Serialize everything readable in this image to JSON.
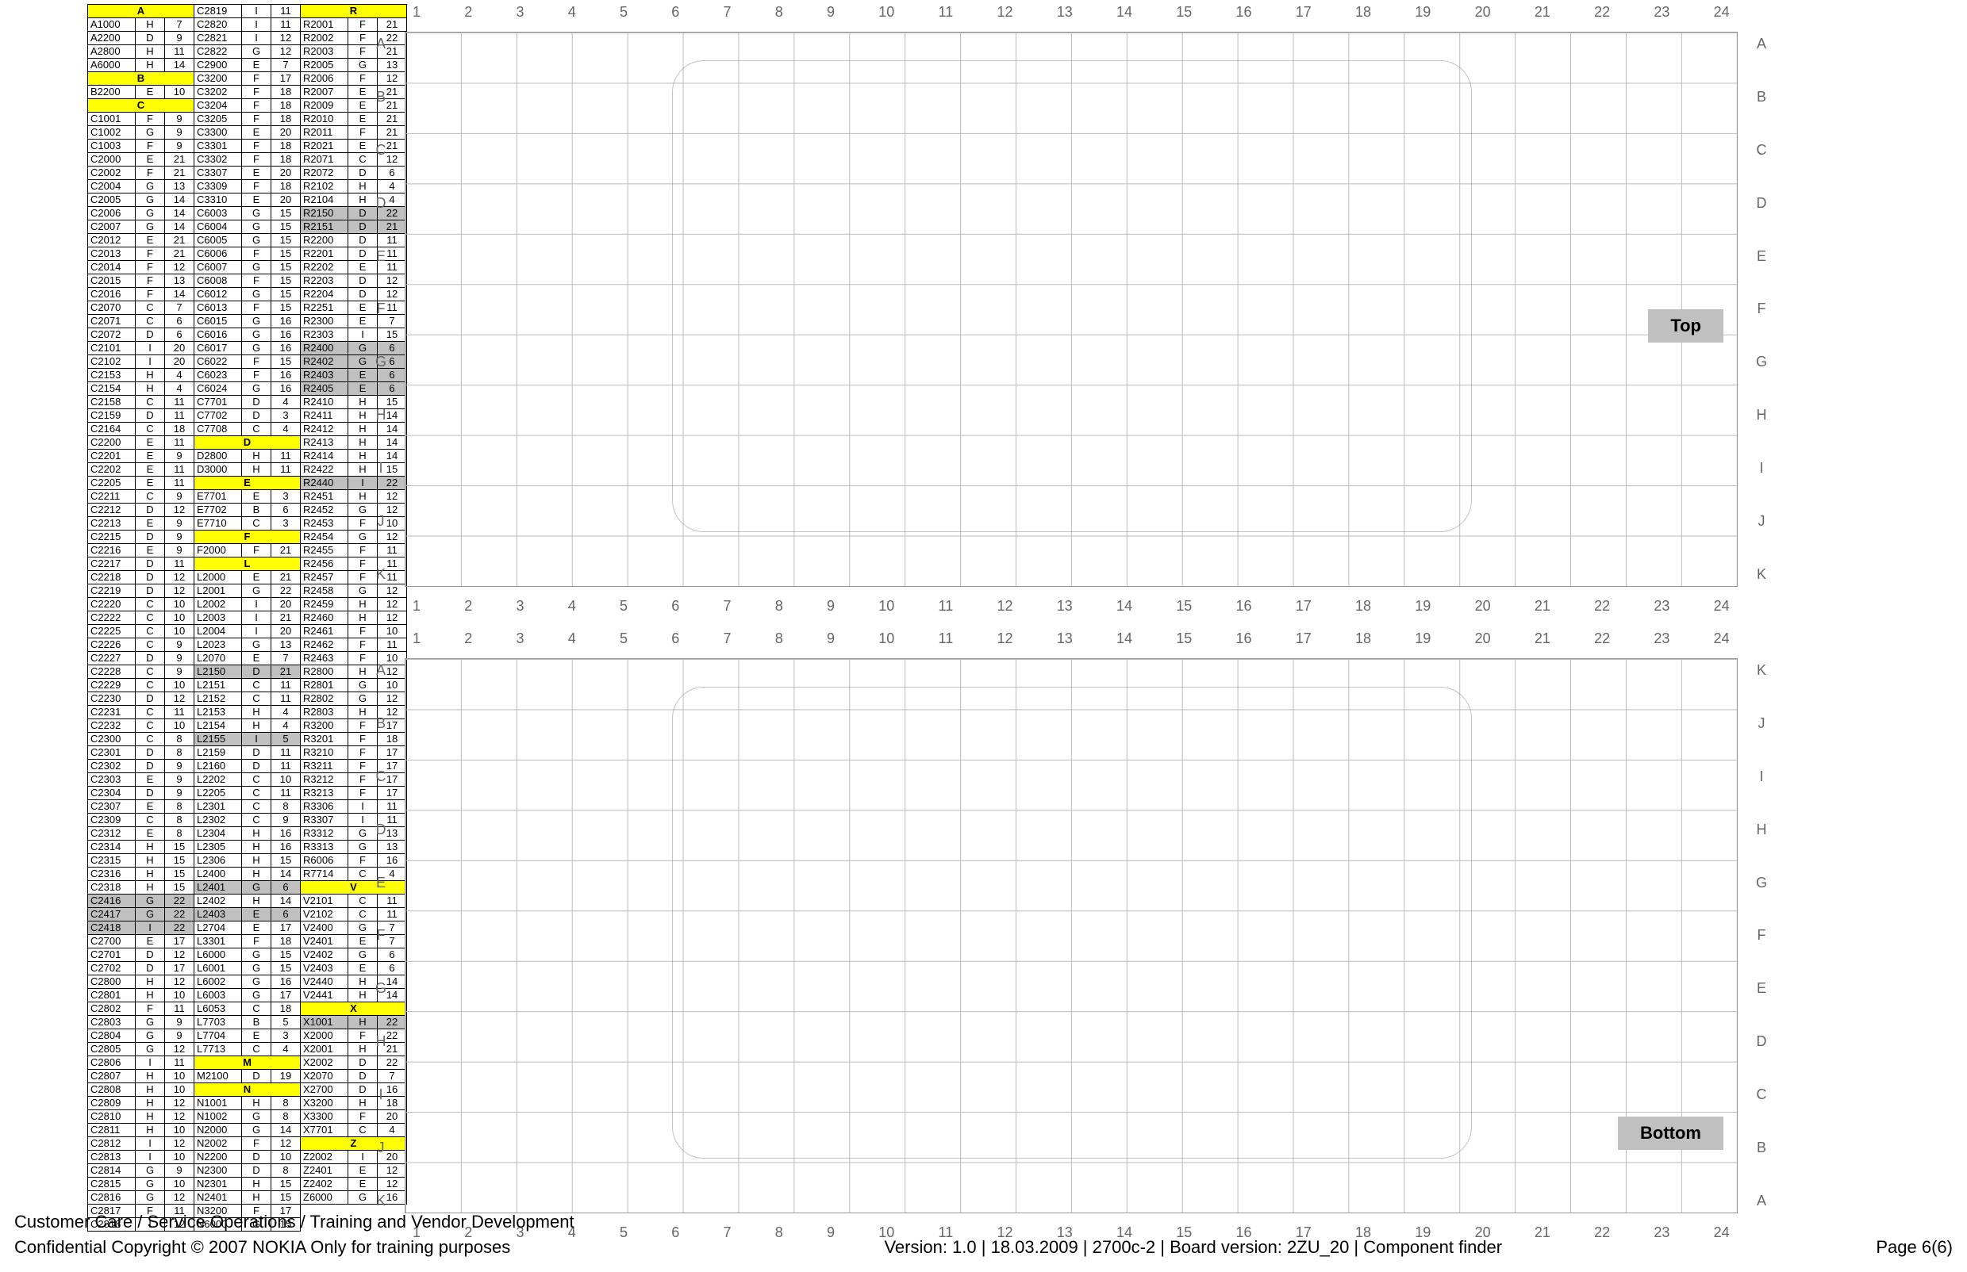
{
  "side_labels": {
    "top": "Top",
    "bottom": "Bottom"
  },
  "grid_cols": [
    "1",
    "2",
    "3",
    "4",
    "5",
    "6",
    "7",
    "8",
    "9",
    "10",
    "11",
    "12",
    "13",
    "14",
    "15",
    "16",
    "17",
    "18",
    "19",
    "20",
    "21",
    "22",
    "23",
    "24"
  ],
  "grid_rows": [
    "A",
    "B",
    "C",
    "D",
    "E",
    "F",
    "G",
    "H",
    "I",
    "J",
    "K"
  ],
  "footer": {
    "line1": "Customer Care / Service Operations / Training and Vendor Development",
    "line2": "Confidential Copyright © 2007 NOKIA Only for training purposes",
    "version": "Version: 1.0 | 18.03.2009 | 2700c-2 | Board version: 2ZU_20 | Component finder",
    "page": "Page 6(6)"
  },
  "columns": [
    [
      {
        "hdr": "A"
      },
      [
        "A1000",
        "H",
        "7"
      ],
      [
        "A2200",
        "D",
        "9"
      ],
      [
        "A2800",
        "H",
        "11"
      ],
      [
        "A6000",
        "H",
        "14"
      ],
      {
        "hdr": "B"
      },
      [
        "B2200",
        "E",
        "10"
      ],
      {
        "hdr": "C"
      },
      [
        "C1001",
        "F",
        "9"
      ],
      [
        "C1002",
        "G",
        "9"
      ],
      [
        "C1003",
        "F",
        "9"
      ],
      [
        "C2000",
        "E",
        "21"
      ],
      [
        "C2002",
        "F",
        "21"
      ],
      [
        "C2004",
        "G",
        "13"
      ],
      [
        "C2005",
        "G",
        "14"
      ],
      [
        "C2006",
        "G",
        "14"
      ],
      [
        "C2007",
        "G",
        "14"
      ],
      [
        "C2012",
        "E",
        "21"
      ],
      [
        "C2013",
        "F",
        "21"
      ],
      [
        "C2014",
        "F",
        "12"
      ],
      [
        "C2015",
        "F",
        "13"
      ],
      [
        "C2016",
        "F",
        "14"
      ],
      [
        "C2070",
        "C",
        "7"
      ],
      [
        "C2071",
        "C",
        "6"
      ],
      [
        "C2072",
        "D",
        "6"
      ],
      [
        "C2101",
        "I",
        "20"
      ],
      [
        "C2102",
        "I",
        "20"
      ],
      [
        "C2153",
        "H",
        "4"
      ],
      [
        "C2154",
        "H",
        "4"
      ],
      [
        "C2158",
        "C",
        "11"
      ],
      [
        "C2159",
        "D",
        "11"
      ],
      [
        "C2164",
        "C",
        "18"
      ],
      [
        "C2200",
        "E",
        "11"
      ],
      [
        "C2201",
        "E",
        "9"
      ],
      [
        "C2202",
        "E",
        "11"
      ],
      [
        "C2205",
        "E",
        "11"
      ],
      [
        "C2211",
        "C",
        "9"
      ],
      [
        "C2212",
        "D",
        "12"
      ],
      [
        "C2213",
        "E",
        "9"
      ],
      [
        "C2215",
        "D",
        "9"
      ],
      [
        "C2216",
        "E",
        "9"
      ],
      [
        "C2217",
        "D",
        "11"
      ],
      [
        "C2218",
        "D",
        "12"
      ],
      [
        "C2219",
        "D",
        "12"
      ],
      [
        "C2220",
        "C",
        "10"
      ],
      [
        "C2222",
        "C",
        "10"
      ],
      [
        "C2225",
        "C",
        "10"
      ],
      [
        "C2226",
        "C",
        "9"
      ],
      [
        "C2227",
        "D",
        "9"
      ],
      [
        "C2228",
        "C",
        "9"
      ],
      [
        "C2229",
        "C",
        "10"
      ],
      [
        "C2230",
        "D",
        "12"
      ],
      [
        "C2231",
        "C",
        "11"
      ],
      [
        "C2232",
        "C",
        "10"
      ],
      [
        "C2300",
        "C",
        "8"
      ],
      [
        "C2301",
        "D",
        "8"
      ],
      [
        "C2302",
        "D",
        "9"
      ],
      [
        "C2303",
        "E",
        "9"
      ],
      [
        "C2304",
        "D",
        "9"
      ],
      [
        "C2307",
        "E",
        "8"
      ],
      [
        "C2309",
        "C",
        "8"
      ],
      [
        "C2312",
        "E",
        "8"
      ],
      [
        "C2314",
        "H",
        "15"
      ],
      [
        "C2315",
        "H",
        "15"
      ],
      [
        "C2316",
        "H",
        "15"
      ],
      [
        "C2318",
        "H",
        "15"
      ],
      [
        "C2416",
        "G",
        "22",
        "hl"
      ],
      [
        "C2417",
        "G",
        "22",
        "hl"
      ],
      [
        "C2418",
        "I",
        "22",
        "hl"
      ],
      [
        "C2700",
        "E",
        "17"
      ],
      [
        "C2701",
        "D",
        "12"
      ],
      [
        "C2702",
        "D",
        "17"
      ],
      [
        "C2800",
        "H",
        "12"
      ],
      [
        "C2801",
        "H",
        "10"
      ],
      [
        "C2802",
        "F",
        "11"
      ],
      [
        "C2803",
        "G",
        "9"
      ],
      [
        "C2804",
        "G",
        "9"
      ],
      [
        "C2805",
        "G",
        "12"
      ],
      [
        "C2806",
        "I",
        "11"
      ],
      [
        "C2807",
        "H",
        "10"
      ],
      [
        "C2808",
        "H",
        "10"
      ],
      [
        "C2809",
        "H",
        "12"
      ],
      [
        "C2810",
        "H",
        "12"
      ],
      [
        "C2811",
        "H",
        "10"
      ],
      [
        "C2812",
        "I",
        "12"
      ],
      [
        "C2813",
        "I",
        "10"
      ],
      [
        "C2814",
        "G",
        "9"
      ],
      [
        "C2815",
        "G",
        "10"
      ],
      [
        "C2816",
        "G",
        "12"
      ],
      [
        "C2817",
        "F",
        "11"
      ],
      [
        "C2818",
        "I",
        "12"
      ]
    ],
    [
      [
        "C2819",
        "I",
        "11"
      ],
      [
        "C2820",
        "I",
        "11"
      ],
      [
        "C2821",
        "I",
        "12"
      ],
      [
        "C2822",
        "G",
        "12"
      ],
      [
        "C2900",
        "E",
        "7"
      ],
      [
        "C3200",
        "F",
        "17"
      ],
      [
        "C3202",
        "F",
        "18"
      ],
      [
        "C3204",
        "F",
        "18"
      ],
      [
        "C3205",
        "F",
        "18"
      ],
      [
        "C3300",
        "E",
        "20"
      ],
      [
        "C3301",
        "F",
        "18"
      ],
      [
        "C3302",
        "F",
        "18"
      ],
      [
        "C3307",
        "E",
        "20"
      ],
      [
        "C3309",
        "F",
        "18"
      ],
      [
        "C3310",
        "E",
        "20"
      ],
      [
        "C6003",
        "G",
        "15"
      ],
      [
        "C6004",
        "G",
        "15"
      ],
      [
        "C6005",
        "G",
        "15"
      ],
      [
        "C6006",
        "F",
        "15"
      ],
      [
        "C6007",
        "G",
        "15"
      ],
      [
        "C6008",
        "F",
        "15"
      ],
      [
        "C6012",
        "G",
        "15"
      ],
      [
        "C6013",
        "F",
        "15"
      ],
      [
        "C6015",
        "G",
        "16"
      ],
      [
        "C6016",
        "G",
        "16"
      ],
      [
        "C6017",
        "G",
        "16"
      ],
      [
        "C6022",
        "F",
        "15"
      ],
      [
        "C6023",
        "F",
        "16"
      ],
      [
        "C6024",
        "G",
        "16"
      ],
      [
        "C7701",
        "D",
        "4"
      ],
      [
        "C7702",
        "D",
        "3"
      ],
      [
        "C7708",
        "C",
        "4"
      ],
      {
        "hdr": "D"
      },
      [
        "D2800",
        "H",
        "11"
      ],
      [
        "D3000",
        "H",
        "11"
      ],
      {
        "hdr": "E"
      },
      [
        "E7701",
        "E",
        "3"
      ],
      [
        "E7702",
        "B",
        "6"
      ],
      [
        "E7710",
        "C",
        "3"
      ],
      {
        "hdr": "F"
      },
      [
        "F2000",
        "F",
        "21"
      ],
      {
        "hdr": "L"
      },
      [
        "L2000",
        "E",
        "21"
      ],
      [
        "L2001",
        "G",
        "22"
      ],
      [
        "L2002",
        "I",
        "20"
      ],
      [
        "L2003",
        "I",
        "21"
      ],
      [
        "L2004",
        "I",
        "20"
      ],
      [
        "L2023",
        "G",
        "13"
      ],
      [
        "L2070",
        "E",
        "7"
      ],
      [
        "L2150",
        "D",
        "21",
        "hl"
      ],
      [
        "L2151",
        "C",
        "11"
      ],
      [
        "L2152",
        "C",
        "11"
      ],
      [
        "L2153",
        "H",
        "4"
      ],
      [
        "L2154",
        "H",
        "4"
      ],
      [
        "L2155",
        "I",
        "5",
        "hl"
      ],
      [
        "L2159",
        "D",
        "11"
      ],
      [
        "L2160",
        "D",
        "11"
      ],
      [
        "L2202",
        "C",
        "10"
      ],
      [
        "L2205",
        "C",
        "11"
      ],
      [
        "L2301",
        "C",
        "8"
      ],
      [
        "L2302",
        "C",
        "9"
      ],
      [
        "L2304",
        "H",
        "16"
      ],
      [
        "L2305",
        "H",
        "16"
      ],
      [
        "L2306",
        "H",
        "15"
      ],
      [
        "L2400",
        "H",
        "14"
      ],
      [
        "L2401",
        "G",
        "6",
        "hl"
      ],
      [
        "L2402",
        "H",
        "14"
      ],
      [
        "L2403",
        "E",
        "6",
        "hl"
      ],
      [
        "L2704",
        "E",
        "17"
      ],
      [
        "L3301",
        "F",
        "18"
      ],
      [
        "L6000",
        "G",
        "15"
      ],
      [
        "L6001",
        "G",
        "15"
      ],
      [
        "L6002",
        "G",
        "16"
      ],
      [
        "L6003",
        "G",
        "17"
      ],
      [
        "L6053",
        "C",
        "18"
      ],
      [
        "L7703",
        "B",
        "5"
      ],
      [
        "L7704",
        "E",
        "3"
      ],
      [
        "L7713",
        "C",
        "4"
      ],
      {
        "hdr": "M"
      },
      [
        "M2100",
        "D",
        "19"
      ],
      {
        "hdr": "N"
      },
      [
        "N1001",
        "H",
        "8"
      ],
      [
        "N1002",
        "G",
        "8"
      ],
      [
        "N2000",
        "G",
        "14"
      ],
      [
        "N2002",
        "F",
        "12"
      ],
      [
        "N2200",
        "D",
        "10"
      ],
      [
        "N2300",
        "D",
        "8"
      ],
      [
        "N2301",
        "H",
        "15"
      ],
      [
        "N2401",
        "H",
        "15"
      ],
      [
        "N3200",
        "F",
        "17"
      ],
      [
        "N6000",
        "G",
        "15"
      ]
    ],
    [
      {
        "hdr": "R"
      },
      [
        "R2001",
        "F",
        "21"
      ],
      [
        "R2002",
        "F",
        "22"
      ],
      [
        "R2003",
        "F",
        "21"
      ],
      [
        "R2005",
        "G",
        "13"
      ],
      [
        "R2006",
        "F",
        "12"
      ],
      [
        "R2007",
        "E",
        "21"
      ],
      [
        "R2009",
        "E",
        "21"
      ],
      [
        "R2010",
        "E",
        "21"
      ],
      [
        "R2011",
        "F",
        "21"
      ],
      [
        "R2021",
        "E",
        "21"
      ],
      [
        "R2071",
        "C",
        "12"
      ],
      [
        "R2072",
        "D",
        "6"
      ],
      [
        "R2102",
        "H",
        "4"
      ],
      [
        "R2104",
        "H",
        "4"
      ],
      [
        "R2150",
        "D",
        "22",
        "hl"
      ],
      [
        "R2151",
        "D",
        "21",
        "hl"
      ],
      [
        "R2200",
        "D",
        "11"
      ],
      [
        "R2201",
        "D",
        "11"
      ],
      [
        "R2202",
        "E",
        "11"
      ],
      [
        "R2203",
        "D",
        "12"
      ],
      [
        "R2204",
        "D",
        "12"
      ],
      [
        "R2251",
        "E",
        "11"
      ],
      [
        "R2300",
        "E",
        "7"
      ],
      [
        "R2303",
        "I",
        "15"
      ],
      [
        "R2400",
        "G",
        "6",
        "hl"
      ],
      [
        "R2402",
        "G",
        "6",
        "hl"
      ],
      [
        "R2403",
        "E",
        "6",
        "hl"
      ],
      [
        "R2405",
        "E",
        "6",
        "hl"
      ],
      [
        "R2410",
        "H",
        "15"
      ],
      [
        "R2411",
        "H",
        "14"
      ],
      [
        "R2412",
        "H",
        "14"
      ],
      [
        "R2413",
        "H",
        "14"
      ],
      [
        "R2414",
        "H",
        "14"
      ],
      [
        "R2422",
        "H",
        "15"
      ],
      [
        "R2440",
        "I",
        "22",
        "hl"
      ],
      [
        "R2451",
        "H",
        "12"
      ],
      [
        "R2452",
        "G",
        "12"
      ],
      [
        "R2453",
        "F",
        "10"
      ],
      [
        "R2454",
        "G",
        "12"
      ],
      [
        "R2455",
        "F",
        "11"
      ],
      [
        "R2456",
        "F",
        "11"
      ],
      [
        "R2457",
        "F",
        "11"
      ],
      [
        "R2458",
        "G",
        "12"
      ],
      [
        "R2459",
        "H",
        "12"
      ],
      [
        "R2460",
        "H",
        "12"
      ],
      [
        "R2461",
        "F",
        "10"
      ],
      [
        "R2462",
        "F",
        "11"
      ],
      [
        "R2463",
        "F",
        "10"
      ],
      [
        "R2800",
        "H",
        "12"
      ],
      [
        "R2801",
        "G",
        "10"
      ],
      [
        "R2802",
        "G",
        "12"
      ],
      [
        "R2803",
        "H",
        "12"
      ],
      [
        "R3200",
        "F",
        "17"
      ],
      [
        "R3201",
        "F",
        "18"
      ],
      [
        "R3210",
        "F",
        "17"
      ],
      [
        "R3211",
        "F",
        "17"
      ],
      [
        "R3212",
        "F",
        "17"
      ],
      [
        "R3213",
        "F",
        "17"
      ],
      [
        "R3306",
        "I",
        "11"
      ],
      [
        "R3307",
        "I",
        "11"
      ],
      [
        "R3312",
        "G",
        "13"
      ],
      [
        "R3313",
        "G",
        "13"
      ],
      [
        "R6006",
        "F",
        "16"
      ],
      [
        "R7714",
        "C",
        "4"
      ],
      {
        "hdr": "V"
      },
      [
        "V2101",
        "C",
        "11"
      ],
      [
        "V2102",
        "C",
        "11"
      ],
      [
        "V2400",
        "G",
        "7"
      ],
      [
        "V2401",
        "E",
        "7"
      ],
      [
        "V2402",
        "G",
        "6"
      ],
      [
        "V2403",
        "E",
        "6"
      ],
      [
        "V2440",
        "H",
        "14"
      ],
      [
        "V2441",
        "H",
        "14"
      ],
      {
        "hdr": "X"
      },
      [
        "X1001",
        "H",
        "22",
        "hl"
      ],
      [
        "X2000",
        "F",
        "22"
      ],
      [
        "X2001",
        "H",
        "21"
      ],
      [
        "X2002",
        "D",
        "22"
      ],
      [
        "X2070",
        "D",
        "7"
      ],
      [
        "X2700",
        "D",
        "16"
      ],
      [
        "X3200",
        "H",
        "18"
      ],
      [
        "X3300",
        "F",
        "20"
      ],
      [
        "X7701",
        "C",
        "4"
      ],
      {
        "hdr": "Z"
      },
      [
        "Z2002",
        "I",
        "20"
      ],
      [
        "Z2401",
        "E",
        "12"
      ],
      [
        "Z2402",
        "E",
        "12"
      ],
      [
        "Z6000",
        "G",
        "16"
      ]
    ]
  ]
}
